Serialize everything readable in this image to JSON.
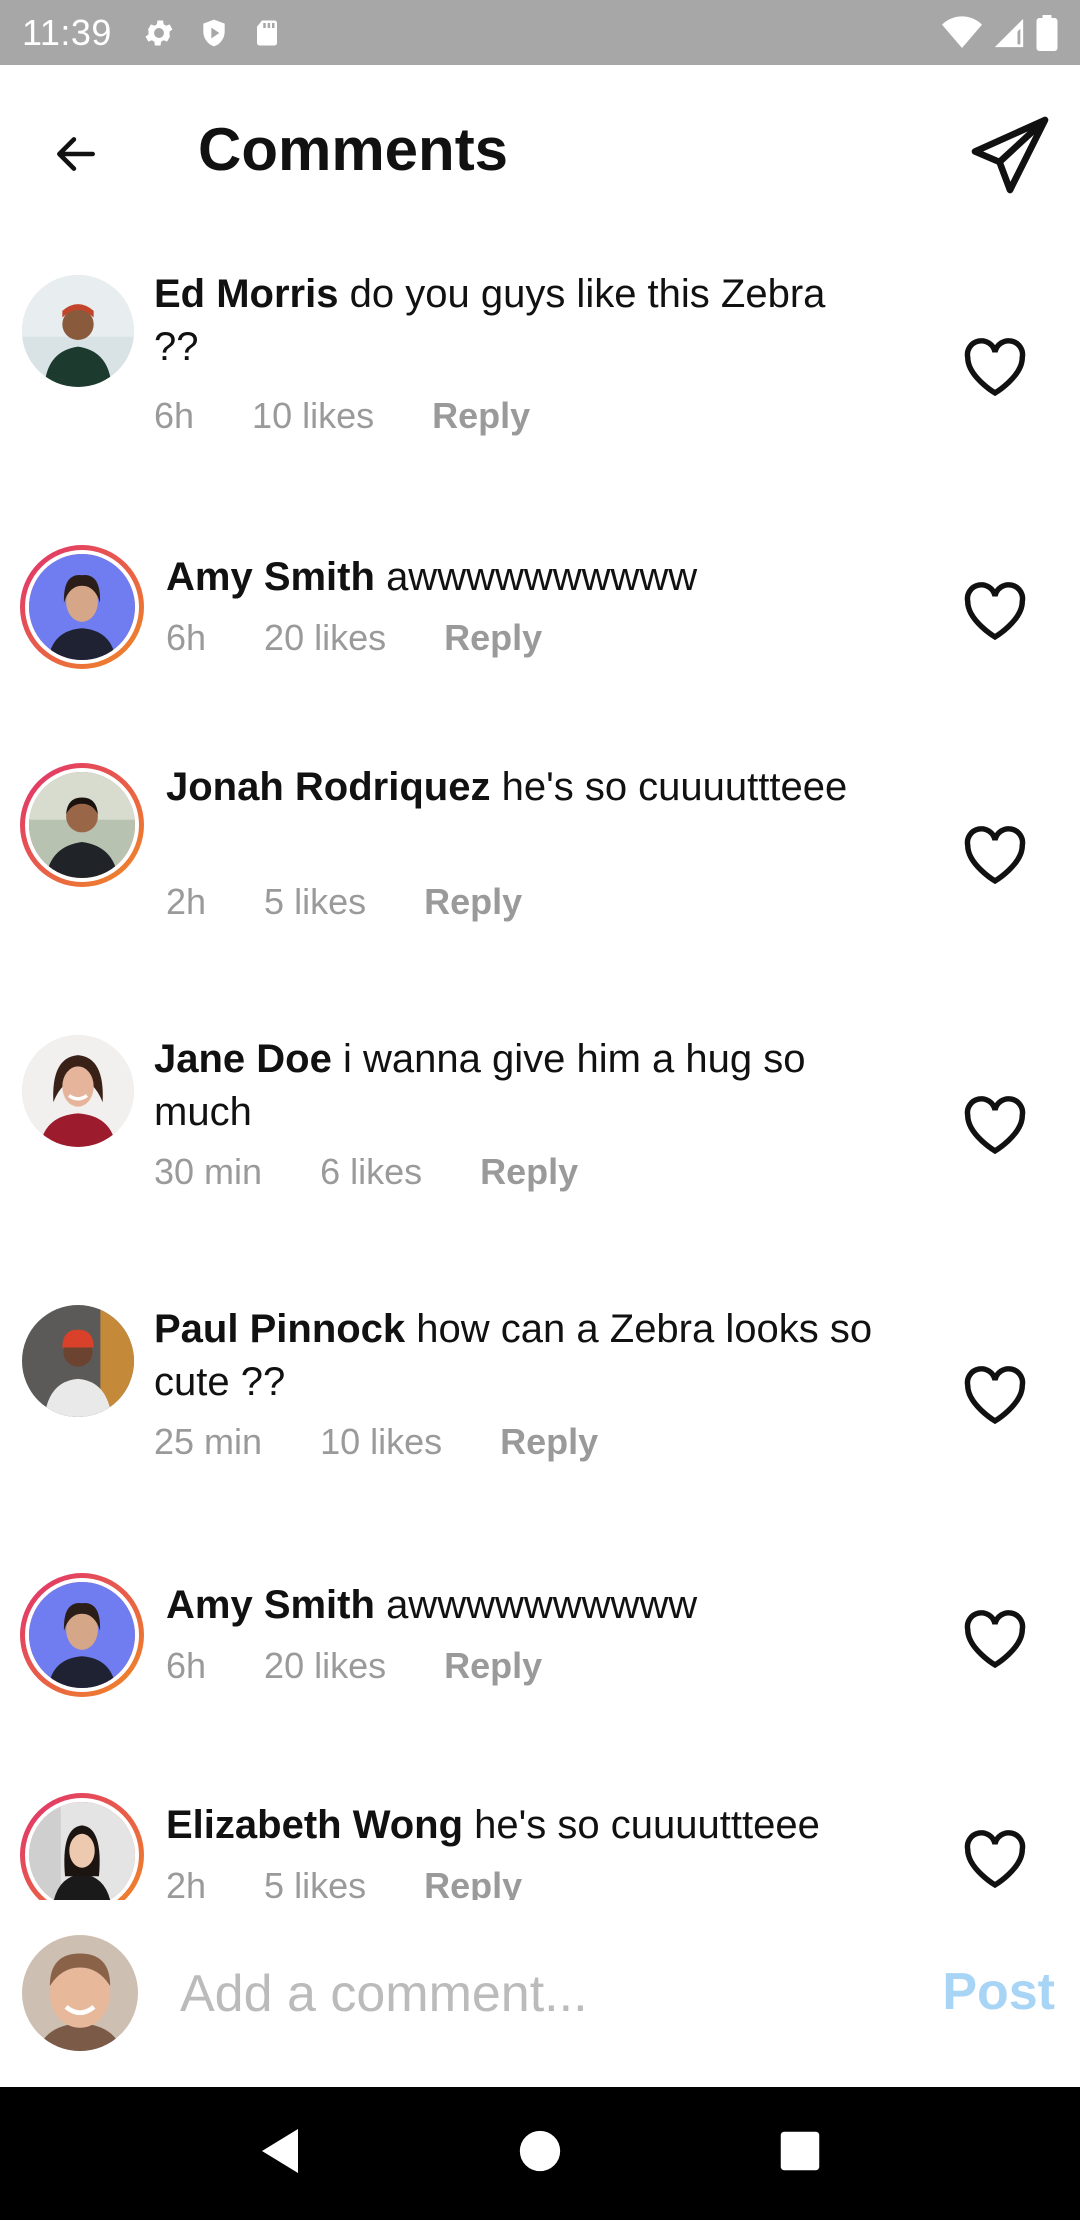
{
  "status_bar": {
    "time": "11:39",
    "icons_left": [
      "gear-icon",
      "shield-icon",
      "sd-card-icon"
    ],
    "icons_right": [
      "wifi-icon",
      "signal-icon",
      "battery-icon"
    ]
  },
  "header": {
    "title": "Comments",
    "back_icon": "arrow-left-icon",
    "send_icon": "paper-plane-icon"
  },
  "comments": [
    {
      "author": "Ed Morris",
      "text": "do you guys like this Zebra ??",
      "time": "6h",
      "likes": "10 likes",
      "reply": "Reply",
      "story_ring": false
    },
    {
      "author": "Amy Smith",
      "text": "awwwwwwwwww",
      "time": "6h",
      "likes": "20 likes",
      "reply": "Reply",
      "story_ring": true
    },
    {
      "author": "Jonah Rodriquez",
      "text": "he's so cuuuuttteee",
      "time": "2h",
      "likes": "5 likes",
      "reply": "Reply",
      "story_ring": true
    },
    {
      "author": "Jane Doe",
      "text": "i wanna give him a hug so much",
      "time": "30 min",
      "likes": "6 likes",
      "reply": "Reply",
      "story_ring": false
    },
    {
      "author": "Paul Pinnock",
      "text": "how can a Zebra looks so cute ??",
      "time": "25 min",
      "likes": "10 likes",
      "reply": "Reply",
      "story_ring": false
    },
    {
      "author": "Amy Smith",
      "text": "awwwwwwwwww",
      "time": "6h",
      "likes": "20 likes",
      "reply": "Reply",
      "story_ring": true
    },
    {
      "author": "Elizabeth Wong",
      "text": "he's so cuuuuttteee",
      "time": "2h",
      "likes": "5 likes",
      "reply": "Reply",
      "story_ring": true
    }
  ],
  "composer": {
    "placeholder": "Add a comment...",
    "post_label": "Post",
    "post_color": "#a8d5f5"
  },
  "colors": {
    "status_bar": "#a7a7a7",
    "story_ring_start": "#e0306f",
    "story_ring_end": "#f08a24",
    "meta_text": "#9a9a9a"
  }
}
